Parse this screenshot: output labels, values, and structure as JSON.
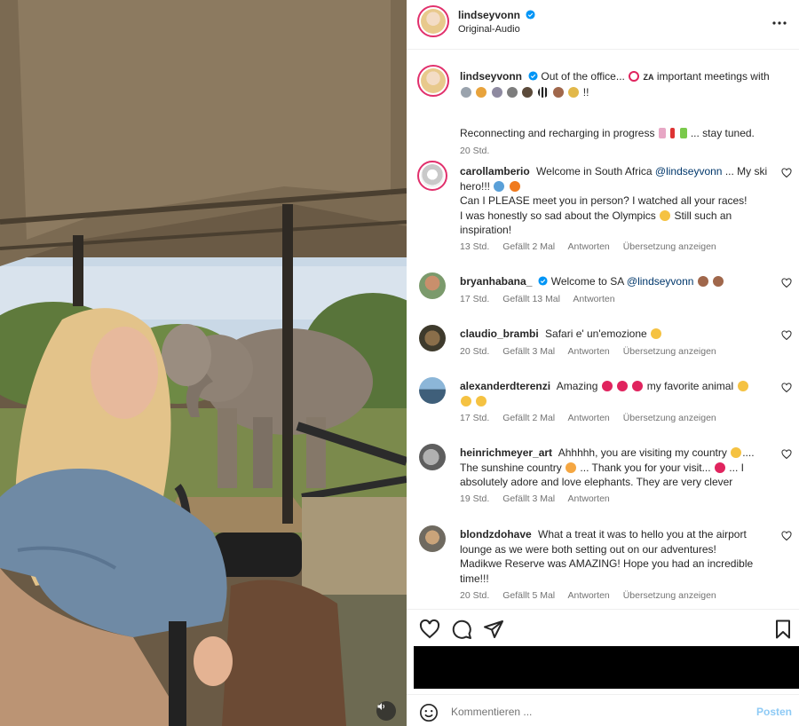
{
  "post": {
    "author": "lindseyvonn",
    "audio": "Original-Audio",
    "caption_user": "lindseyvonn",
    "caption_line1": "Out of the office...",
    "caption_line1_b": "important meetings with",
    "caption_line1_cc": "ZA",
    "caption_line2_end": "!!",
    "caption_line3": "Reconnecting and recharging in progress",
    "caption_line3_end": "... stay tuned.",
    "caption_time": "20 Std."
  },
  "comments": [
    {
      "user": "carollamberio",
      "text1": "Welcome in South Africa",
      "mention": "@lindseyvonn",
      "text1_end": "... My ski",
      "text2": "hero!!!",
      "text3": "Can I PLEASE meet you in person? I watched all your races!",
      "text4": "I was honestly so sad about the Olympics",
      "text4_end": "Still such an",
      "text5": "inspiration!",
      "time": "13 Std.",
      "likes": "Gefällt 2 Mal",
      "reply": "Antworten",
      "translate": "Übersetzung anzeigen"
    },
    {
      "user": "bryanhabana_",
      "text1": "Welcome to SA",
      "mention": "@lindseyvonn",
      "time": "17 Std.",
      "likes": "Gefällt 13 Mal",
      "reply": "Antworten"
    },
    {
      "user": "claudio_brambi",
      "text1": "Safari e' un'emozione",
      "time": "20 Std.",
      "likes": "Gefällt 3 Mal",
      "reply": "Antworten",
      "translate": "Übersetzung anzeigen"
    },
    {
      "user": "alexanderdterenzi",
      "text1": "Amazing",
      "text1_end": "my favorite animal",
      "time": "17 Std.",
      "likes": "Gefällt 2 Mal",
      "reply": "Antworten",
      "translate": "Übersetzung anzeigen"
    },
    {
      "user": "heinrichmeyer_art",
      "text1": "Ahhhhh, you are visiting my country",
      "text1_end": "....",
      "text2": "The sunshine country",
      "text2_b": "... Thank you for your visit...",
      "text2_end": "... I",
      "text3": "absolutely adore and love elephants. They are very clever",
      "time": "19 Std.",
      "likes": "Gefällt 3 Mal",
      "reply": "Antworten"
    },
    {
      "user": "blondzdohave",
      "text1": "What a treat it was to hello you at the airport",
      "text2": "lounge as we were both setting out on our adventures!",
      "text3": "Madikwe Reserve was AMAZING! Hope you had an incredible",
      "text4": "time!!!",
      "time": "20 Std.",
      "likes": "Gefällt 5 Mal",
      "reply": "Antworten",
      "translate": "Übersetzung anzeigen"
    }
  ],
  "comment_box": {
    "placeholder": "Kommentieren ...",
    "post_label": "Posten"
  },
  "icons": {
    "more": "more-horizontal-icon",
    "like": "heart-icon",
    "comment": "comment-icon",
    "share": "share-icon",
    "save": "bookmark-icon",
    "emoji": "smiley-icon",
    "mute": "speaker-icon",
    "verified": "verified-badge-icon"
  },
  "colors": {
    "accent_link": "#00376b",
    "verified": "#0095f6",
    "post_button_disabled": "#8ecaf5",
    "meta_text": "#737373"
  }
}
